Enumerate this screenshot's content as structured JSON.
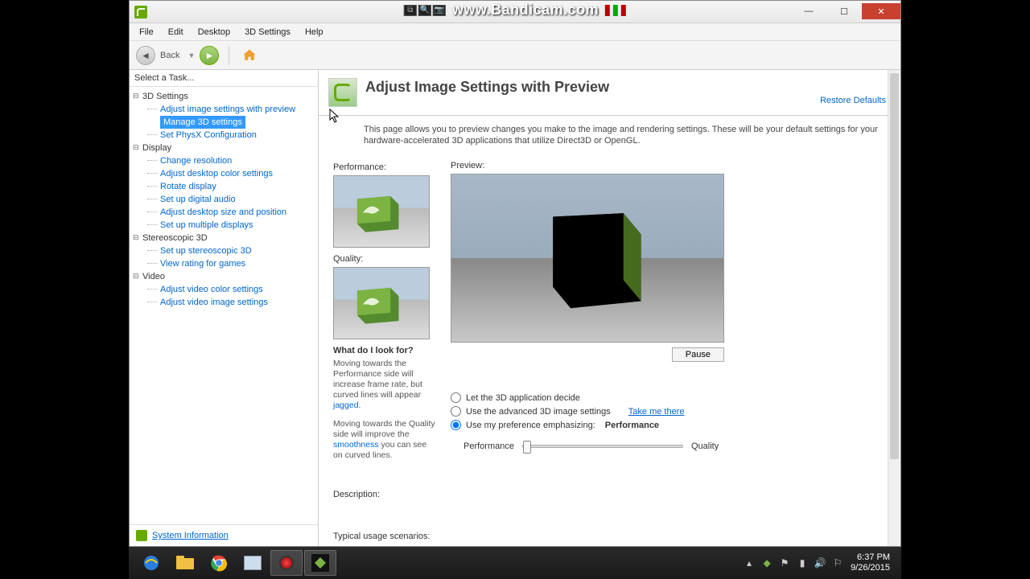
{
  "bandicam": {
    "url": "www.Bandicam.com"
  },
  "window": {
    "title": ""
  },
  "menu": {
    "file": "File",
    "edit": "Edit",
    "desktop": "Desktop",
    "settings3d": "3D Settings",
    "help": "Help"
  },
  "toolbar": {
    "back": "Back"
  },
  "sidebar": {
    "header": "Select a Task...",
    "cats": {
      "c0": "3D Settings",
      "c1": "Display",
      "c2": "Stereoscopic 3D",
      "c3": "Video"
    },
    "items": {
      "i0": "Adjust image settings with preview",
      "i1": "Manage 3D settings",
      "i2": "Set PhysX Configuration",
      "i3": "Change resolution",
      "i4": "Adjust desktop color settings",
      "i5": "Rotate display",
      "i6": "Set up digital audio",
      "i7": "Adjust desktop size and position",
      "i8": "Set up multiple displays",
      "i9": "Set up stereoscopic 3D",
      "i10": "View rating for games",
      "i11": "Adjust video color settings",
      "i12": "Adjust video image settings"
    },
    "sysinfo": "System Information"
  },
  "page": {
    "title": "Adjust Image Settings with Preview",
    "restore": "Restore Defaults",
    "desc": "This page allows you to preview changes you make to the image and rendering settings. These will be your default settings for your hardware-accelerated 3D applications that utilize Direct3D or OpenGL.",
    "perf_label": "Performance:",
    "qual_label": "Quality:",
    "preview_label": "Preview:",
    "pause": "Pause",
    "help_hdr": "What do I look for?",
    "help1a": "Moving towards the Performance side will increase frame rate, but curved lines will appear ",
    "help1_link": "jagged",
    "help1b": ".",
    "help2a": "Moving towards the Quality side will improve the ",
    "help2_link": "smoothness",
    "help2b": " you can see on curved lines.",
    "opt1": "Let the 3D application decide",
    "opt2": "Use the advanced 3D image settings",
    "opt2_link": "Take me there",
    "opt3": "Use my preference emphasizing:",
    "opt3_value": "Performance",
    "slider_left": "Performance",
    "slider_right": "Quality",
    "desc_label": "Description:",
    "usage_label": "Typical usage scenarios:"
  },
  "taskbar": {
    "time": "6:37 PM",
    "date": "9/26/2015"
  }
}
